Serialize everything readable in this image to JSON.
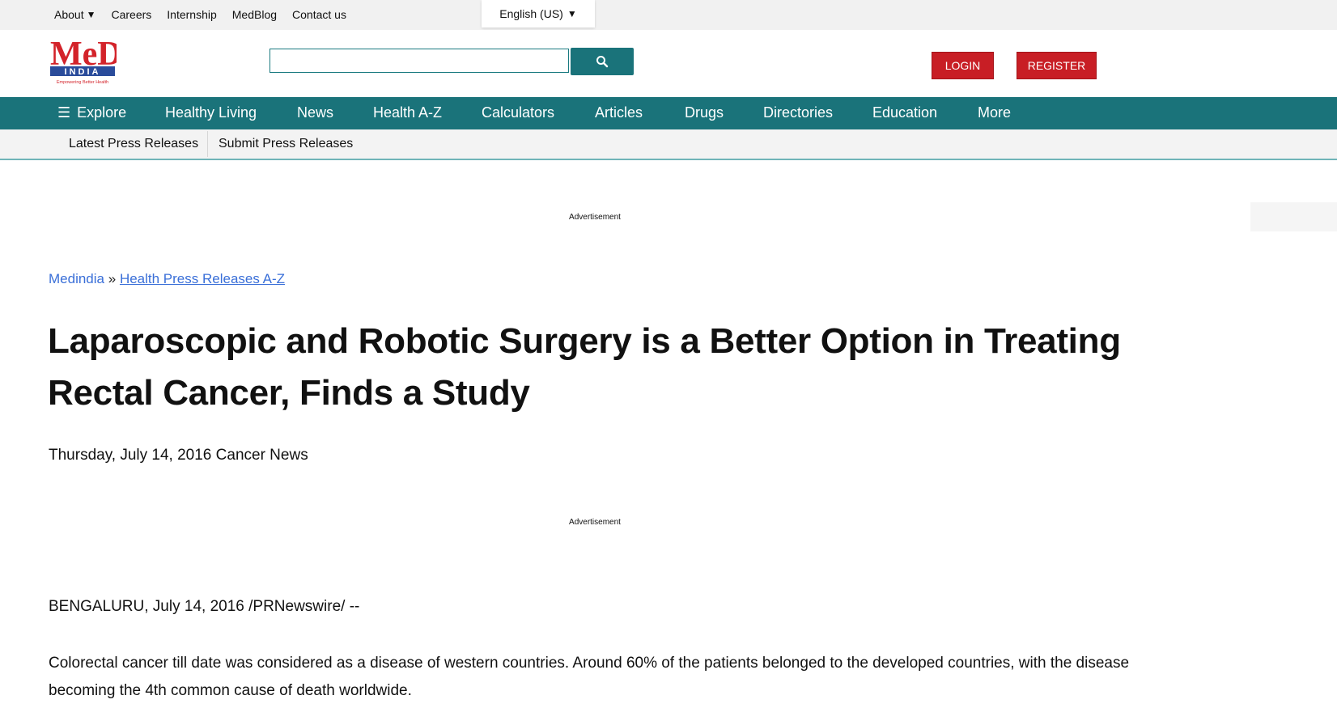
{
  "topbar": {
    "links": [
      "About",
      "Careers",
      "Internship",
      "MedBlog",
      "Contact us"
    ],
    "about_arrow": "▼",
    "language": "English (US)",
    "language_arrow": "▼"
  },
  "logo": {
    "line1": "MeD",
    "line2": "INDIA",
    "tagline": "Empowering Better Health"
  },
  "search": {
    "placeholder": "",
    "value": ""
  },
  "auth": {
    "login": "LOGIN",
    "register": "REGISTER"
  },
  "mainnav": {
    "hamburger": "☰",
    "items": [
      "Explore",
      "Healthy Living",
      "News",
      "Health A-Z",
      "Calculators",
      "Articles",
      "Drugs",
      "Directories",
      "Education",
      "More"
    ]
  },
  "subnav": {
    "items": [
      "Latest Press Releases",
      "Submit Press Releases"
    ]
  },
  "ads": {
    "label": "Advertisement"
  },
  "breadcrumb": {
    "home": "Medindia",
    "sep": "»",
    "current": "Health Press Releases A-Z"
  },
  "article": {
    "title": "Laparoscopic and Robotic Surgery is a Better Option in Treating Rectal Cancer, Finds a Study",
    "meta": "Thursday, July 14, 2016 Cancer News",
    "dateline": "BENGALURU, July 14, 2016 /PRNewswire/ --",
    "paragraph": "Colorectal cancer till date was considered as a disease of western countries. Around 60% of the patients belonged to the developed countries, with the disease becoming the 4th common cause of death worldwide."
  },
  "colors": {
    "teal": "#1a737a",
    "red": "#c81e25",
    "link": "#3a6fd8"
  }
}
